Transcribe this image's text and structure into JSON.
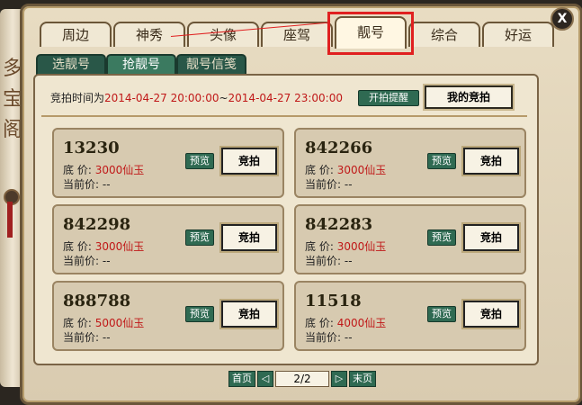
{
  "window": {
    "side_banner": "多宝阁",
    "close": "X"
  },
  "tabs": [
    {
      "label": "周边"
    },
    {
      "label": "神秀"
    },
    {
      "label": "头像"
    },
    {
      "label": "座驾"
    },
    {
      "label": "靓号"
    },
    {
      "label": "综合"
    },
    {
      "label": "好运"
    }
  ],
  "subtabs": [
    {
      "label": "选靓号"
    },
    {
      "label": "抢靓号"
    },
    {
      "label": "靓号信笺"
    }
  ],
  "auction": {
    "time_prefix": "竞拍时间为",
    "start": "2014-04-27 20:00:00",
    "sep": "~",
    "end": "2014-04-27 23:00:00",
    "remind_btn": "开拍提醒",
    "my_bid_btn": "我的竞拍"
  },
  "cards": [
    {
      "number": "13230",
      "base_label": "底  价:",
      "base_price": "3000仙玉",
      "current_label": "当前价:",
      "current_price": "--",
      "preview": "预览",
      "bid": "竞拍"
    },
    {
      "number": "842266",
      "base_label": "底  价:",
      "base_price": "3000仙玉",
      "current_label": "当前价:",
      "current_price": "--",
      "preview": "预览",
      "bid": "竞拍"
    },
    {
      "number": "842298",
      "base_label": "底  价:",
      "base_price": "3000仙玉",
      "current_label": "当前价:",
      "current_price": "--",
      "preview": "预览",
      "bid": "竞拍"
    },
    {
      "number": "842283",
      "base_label": "底  价:",
      "base_price": "3000仙玉",
      "current_label": "当前价:",
      "current_price": "--",
      "preview": "预览",
      "bid": "竞拍"
    },
    {
      "number": "888788",
      "base_label": "底  价:",
      "base_price": "5000仙玉",
      "current_label": "当前价:",
      "current_price": "--",
      "preview": "预览",
      "bid": "竞拍"
    },
    {
      "number": "11518",
      "base_label": "底  价:",
      "base_price": "4000仙玉",
      "current_label": "当前价:",
      "current_price": "--",
      "preview": "预览",
      "bid": "竞拍"
    }
  ],
  "pager": {
    "first": "首页",
    "prev": "◁",
    "page": "2/2",
    "next": "▷",
    "last": "末页"
  }
}
